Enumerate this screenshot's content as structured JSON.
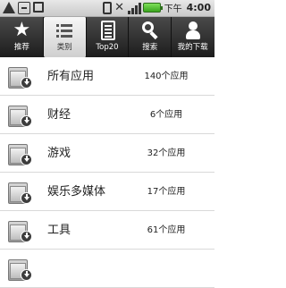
{
  "status_bar": {
    "time": "4:00",
    "ampm": "下午",
    "icons": [
      "warning-icon",
      "usb-icon",
      "sdcard-icon",
      "vibrate-icon",
      "no-signal-icon",
      "signal-icon",
      "battery-icon"
    ]
  },
  "tabs": [
    {
      "label": "推荐",
      "icon": "star-icon",
      "active": false
    },
    {
      "label": "类别",
      "icon": "list-icon",
      "active": true
    },
    {
      "label": "Top20",
      "icon": "document-icon",
      "active": false
    },
    {
      "label": "搜索",
      "icon": "search-icon",
      "active": false
    },
    {
      "label": "我的下载",
      "icon": "person-icon",
      "active": false
    }
  ],
  "categories": [
    {
      "name": "所有应用",
      "count": "140个应用"
    },
    {
      "name": "财经",
      "count": "6个应用"
    },
    {
      "name": "游戏",
      "count": "32个应用"
    },
    {
      "name": "娱乐多媒体",
      "count": "17个应用"
    },
    {
      "name": "工具",
      "count": "61个应用"
    },
    {
      "name": "",
      "count": ""
    }
  ]
}
